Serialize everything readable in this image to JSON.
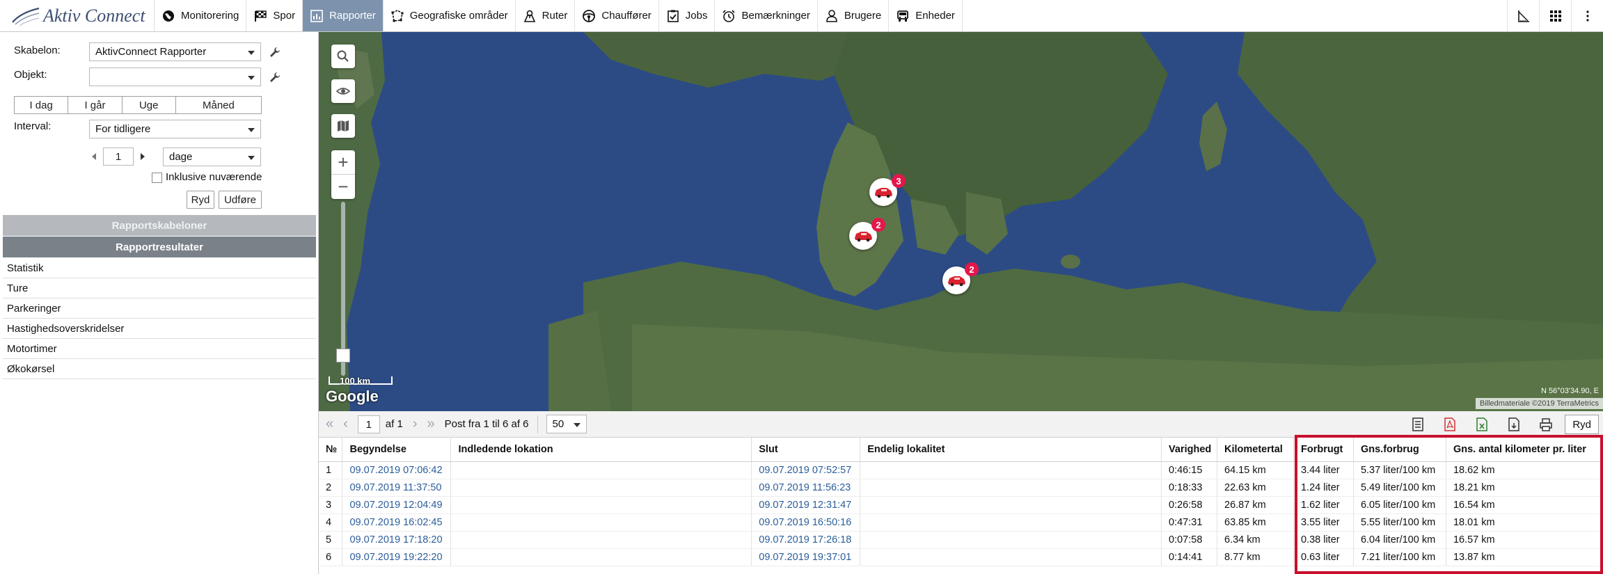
{
  "app": {
    "brand": "Aktiv Connect"
  },
  "nav": [
    {
      "label": "Monitorering",
      "icon": "globe-icon",
      "active": false
    },
    {
      "label": "Spor",
      "icon": "flag-icon",
      "active": false
    },
    {
      "label": "Rapporter",
      "icon": "report-icon",
      "active": true
    },
    {
      "label": "Geografiske områder",
      "icon": "polygon-icon",
      "active": false
    },
    {
      "label": "Ruter",
      "icon": "route-icon",
      "active": false
    },
    {
      "label": "Chauffører",
      "icon": "steering-wheel-icon",
      "active": false
    },
    {
      "label": "Jobs",
      "icon": "clipboard-icon",
      "active": false
    },
    {
      "label": "Bemærkninger",
      "icon": "alarm-clock-icon",
      "active": false
    },
    {
      "label": "Brugere",
      "icon": "user-icon",
      "active": false
    },
    {
      "label": "Enheder",
      "icon": "vehicle-icon",
      "active": false
    }
  ],
  "panel": {
    "template_label": "Skabelon:",
    "template_value": "AktivConnect Rapporter",
    "object_label": "Objekt:",
    "object_value": "",
    "periods": [
      "I dag",
      "I går",
      "Uge",
      "Måned"
    ],
    "interval_label": "Interval:",
    "interval_value": "For tidligere",
    "interval_count": "1",
    "interval_unit": "dage",
    "include_current_label": "Inklusive nuværende",
    "include_current_checked": false,
    "clear_label": "Ryd",
    "execute_label": "Udføre",
    "templates_header": "Rapportskabeloner",
    "results_header": "Rapportresultater",
    "results": [
      "Statistik",
      "Ture",
      "Parkeringer",
      "Hastighedsoverskridelser",
      "Motortimer",
      "Økokørsel"
    ]
  },
  "map": {
    "scale_label": "100 km",
    "provider": "Google",
    "attribution": "Billedmateriale ©2019 TerraMetrics",
    "coords": "N 56°03'34.90, E",
    "markers": [
      {
        "count": "3"
      },
      {
        "count": "2"
      },
      {
        "count": "2"
      }
    ]
  },
  "pager": {
    "page": "1",
    "of_label": "af 1",
    "range_label": "Post fra 1 til 6 af 6",
    "page_size": "50",
    "clear_label": "Ryd"
  },
  "table": {
    "columns": [
      "№",
      "Begyndelse",
      "Indledende lokation",
      "Slut",
      "Endelig lokalitet",
      "Varighed",
      "Kilometertal",
      "Forbrugt",
      "Gns.forbrug",
      "Gns. antal kilometer pr. liter"
    ],
    "rows": [
      [
        "1",
        "09.07.2019 07:06:42",
        "",
        "09.07.2019 07:52:57",
        "",
        "0:46:15",
        "64.15 km",
        "3.44 liter",
        "5.37 liter/100 km",
        "18.62 km"
      ],
      [
        "2",
        "09.07.2019 11:37:50",
        "",
        "09.07.2019 11:56:23",
        "",
        "0:18:33",
        "22.63 km",
        "1.24 liter",
        "5.49 liter/100 km",
        "18.21 km"
      ],
      [
        "3",
        "09.07.2019 12:04:49",
        "",
        "09.07.2019 12:31:47",
        "",
        "0:26:58",
        "26.87 km",
        "1.62 liter",
        "6.05 liter/100 km",
        "16.54 km"
      ],
      [
        "4",
        "09.07.2019 16:02:45",
        "",
        "09.07.2019 16:50:16",
        "",
        "0:47:31",
        "63.85 km",
        "3.55 liter",
        "5.55 liter/100 km",
        "18.01 km"
      ],
      [
        "5",
        "09.07.2019 17:18:20",
        "",
        "09.07.2019 17:26:18",
        "",
        "0:07:58",
        "6.34 km",
        "0.38 liter",
        "6.04 liter/100 km",
        "16.57 km"
      ],
      [
        "6",
        "09.07.2019 19:22:20",
        "",
        "09.07.2019 19:37:01",
        "",
        "0:14:41",
        "8.77 km",
        "0.63 liter",
        "7.21 liter/100 km",
        "13.87 km"
      ]
    ]
  },
  "colors": {
    "nav_active": "#7d93ad",
    "link": "#2a5d9a",
    "badge": "#e3174a",
    "highlight": "#c8102e",
    "water": "#2b4a82"
  }
}
